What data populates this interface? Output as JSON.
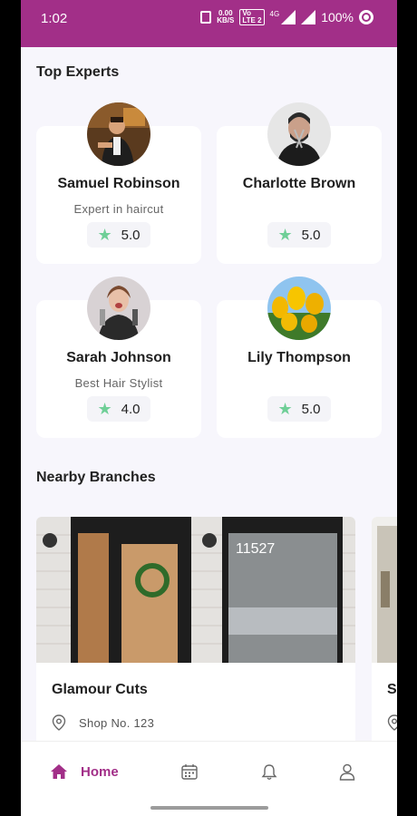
{
  "status_bar": {
    "time": "1:02",
    "net_speed_value": "0.00",
    "net_speed_unit": "KB/S",
    "volte_top": "Vo",
    "volte_bottom": "LTE 2",
    "network": "4G",
    "battery": "100%"
  },
  "sections": {
    "top_experts": "Top Experts",
    "nearby_branches": "Nearby Branches"
  },
  "experts": [
    {
      "name": "Samuel Robinson",
      "role": "Expert in haircut",
      "rating": "5.0",
      "avatar_icon": "barber-photo"
    },
    {
      "name": "Charlotte Brown",
      "role": "",
      "rating": "5.0",
      "avatar_icon": "barber-scissors-photo"
    },
    {
      "name": "Sarah Johnson",
      "role": "Best Hair Stylist",
      "rating": "4.0",
      "avatar_icon": "stylist-photo"
    },
    {
      "name": "Lily Thompson",
      "role": "",
      "rating": "5.0",
      "avatar_icon": "tulips-photo"
    }
  ],
  "branches": [
    {
      "name": "Glamour Cuts",
      "address": "Shop No. 123",
      "storefront_number": "11527"
    },
    {
      "name": "S",
      "address": "",
      "storefront_number": ""
    }
  ],
  "bottom_nav": {
    "home_label": "Home",
    "items": [
      "home-icon",
      "calendar-icon",
      "bell-icon",
      "profile-icon"
    ]
  },
  "colors": {
    "brand": "#a22f88",
    "star": "#6fcf97",
    "background": "#f7f6fc"
  }
}
